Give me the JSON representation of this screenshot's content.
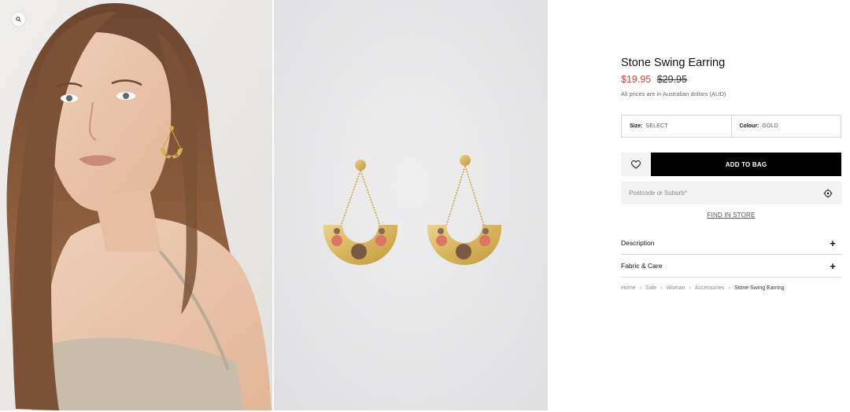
{
  "gallery": {
    "zoom_icon": "search-icon",
    "images": [
      "model-wearing-earring-photo",
      "earring-pair-photo"
    ]
  },
  "product": {
    "title": "Stone Swing Earring",
    "price_sale": "$19.95",
    "price_original": "$29.95",
    "currency_note": "All prices are in Australian dollars (AUD)",
    "size_label": "Size:",
    "size_value": "SELECT",
    "colour_label": "Colour:",
    "colour_value": "GOLD",
    "add_to_bag_label": "ADD TO BAG",
    "wishlist_icon": "heart-icon",
    "postcode_placeholder": "Postcode or Suburb*",
    "locate_icon": "crosshair-icon",
    "find_in_store_label": "FIND IN STORE",
    "accordion": [
      {
        "label": "Description",
        "icon": "+"
      },
      {
        "label": "Fabric & Care",
        "icon": "+"
      }
    ]
  },
  "breadcrumb": {
    "items": [
      "Home",
      "Sale",
      "Woman",
      "Accessories",
      "Stone Swing Earring"
    ],
    "separator": "›"
  },
  "colors": {
    "sale_price": "#e4402f",
    "button_bg": "#000000",
    "field_bg": "#f3f3f3"
  }
}
